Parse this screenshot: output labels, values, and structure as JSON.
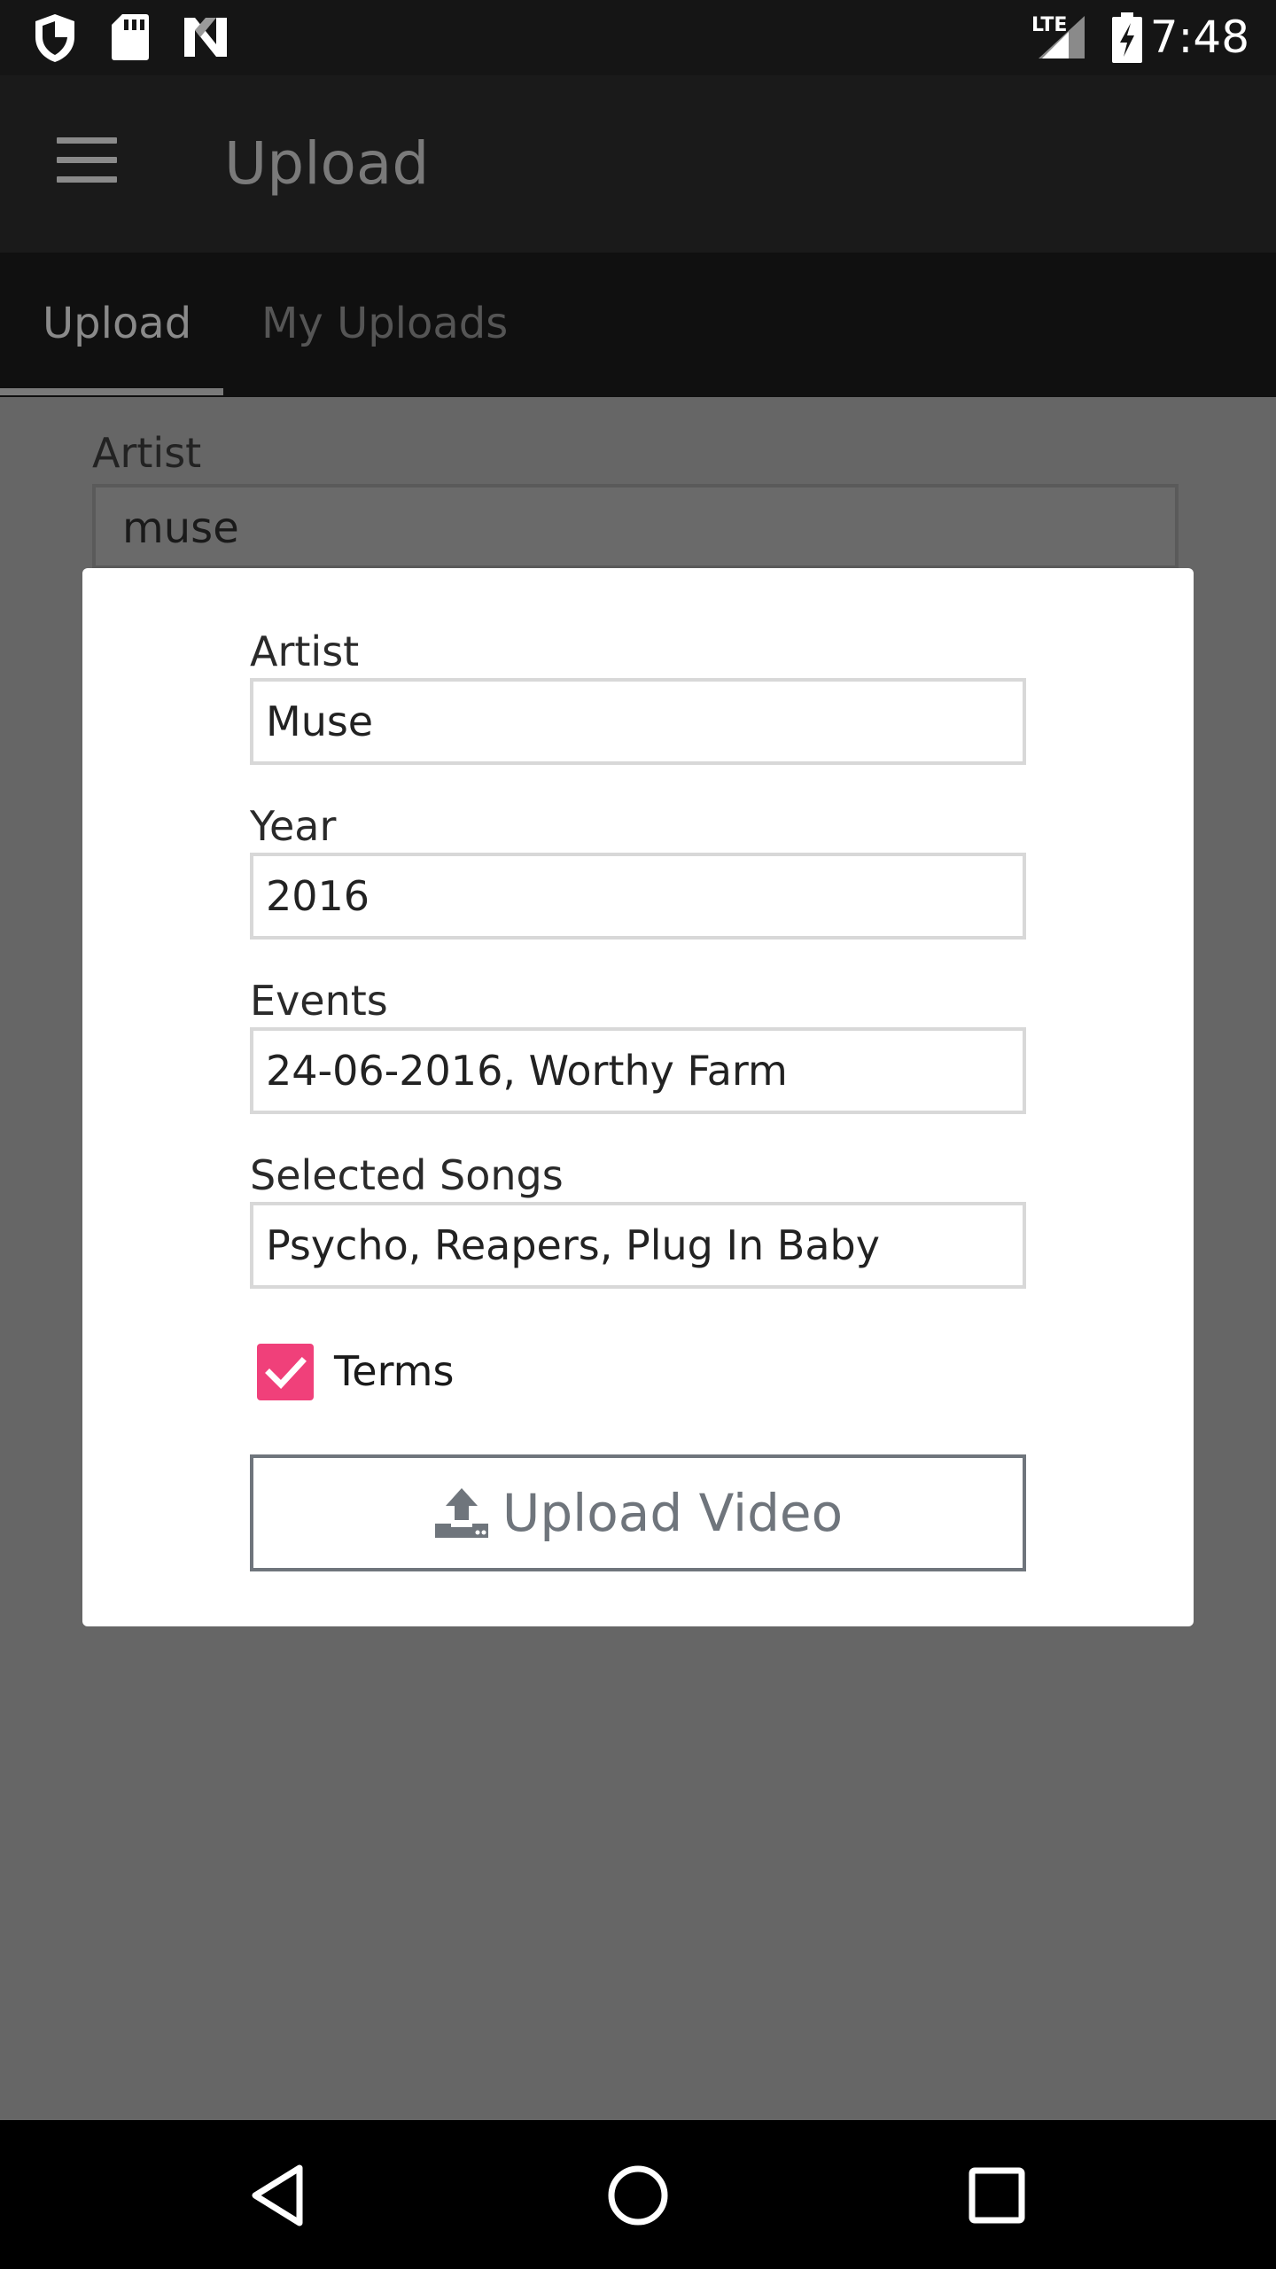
{
  "status_bar": {
    "time": "7:48",
    "network_label": "LTE",
    "icons": [
      "shield-icon",
      "sd-card-icon",
      "n-logo-icon",
      "lte-signal-icon",
      "battery-charging-icon"
    ]
  },
  "app_bar": {
    "title": "Upload",
    "menu_icon": "hamburger-menu-icon"
  },
  "tabs": [
    {
      "label": "Upload",
      "selected": true
    },
    {
      "label": "My Uploads",
      "selected": false
    }
  ],
  "background_form": {
    "artist_label": "Artist",
    "artist_value": "muse"
  },
  "dialog": {
    "fields": {
      "artist": {
        "label": "Artist",
        "value": "Muse"
      },
      "year": {
        "label": "Year",
        "value": "2016"
      },
      "events": {
        "label": "Events",
        "value": "24-06-2016, Worthy Farm"
      },
      "songs": {
        "label": "Selected Songs",
        "value": "Psycho, Reapers, Plug In Baby"
      }
    },
    "terms": {
      "label": "Terms",
      "checked": true
    },
    "upload_button": {
      "label": "Upload Video",
      "icon": "upload-icon"
    }
  },
  "colors": {
    "accent_checkbox": "#f0407a",
    "button_outline": "#6f757c",
    "overlay": "#666666"
  },
  "nav_bar": {
    "icons": [
      "back-icon",
      "home-icon",
      "recents-icon"
    ]
  }
}
